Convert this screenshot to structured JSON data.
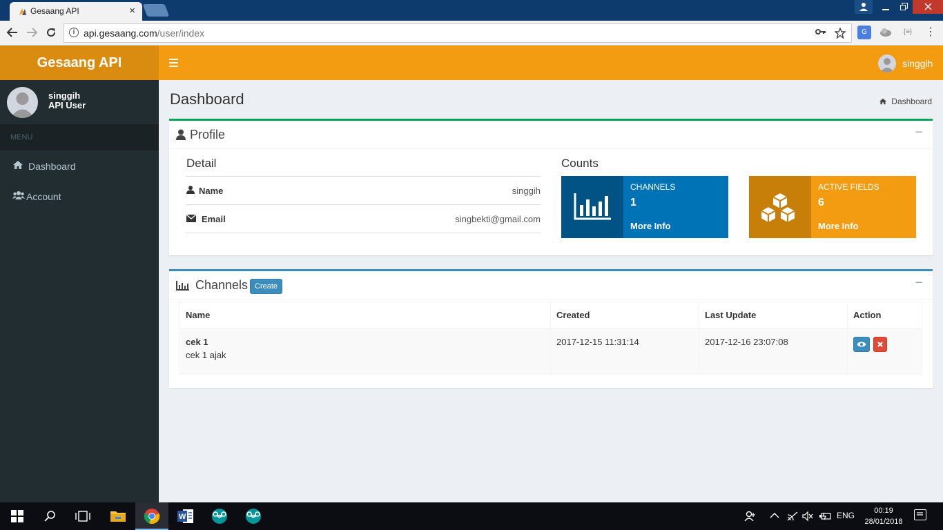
{
  "browser": {
    "tab_title": "Gesaang API",
    "tab_close": "×",
    "url_host": "api.gesaang.com",
    "url_path": "/user/index"
  },
  "app": {
    "logo": "Gesaang API",
    "top_user": "singgih"
  },
  "sidebar": {
    "user_name": "singgih",
    "user_role": "API User",
    "menu_header": "MENU",
    "items": [
      {
        "label": "Dashboard",
        "icon": "home-icon"
      },
      {
        "label": "Account",
        "icon": "users-icon"
      }
    ]
  },
  "page": {
    "title": "Dashboard",
    "breadcrumb": "Dashboard"
  },
  "profile": {
    "box_title": "Profile",
    "collapse": "−",
    "detail_title": "Detail",
    "rows": [
      {
        "label": "Name",
        "value": "singgih",
        "icon": "user-icon"
      },
      {
        "label": "Email",
        "value": "singbekti@gmail.com",
        "icon": "envelope-icon"
      }
    ],
    "counts_title": "Counts",
    "counts": [
      {
        "label": "CHANNELS",
        "value": "1",
        "more": "More Info",
        "icon": "bar-chart-icon",
        "color": "#0073b7"
      },
      {
        "label": "ACTIVE FIELDS",
        "value": "6",
        "more": "More Info",
        "icon": "cubes-icon",
        "color": "#f39c12"
      }
    ]
  },
  "channels": {
    "box_title": "Channels",
    "create_label": "Create",
    "collapse": "−",
    "columns": [
      "Name",
      "Created",
      "Last Update",
      "Action"
    ],
    "rows": [
      {
        "name": "cek 1",
        "description": "cek 1 ajak",
        "created": "2017-12-15 11:31:14",
        "updated": "2017-12-16 23:07:08"
      }
    ]
  },
  "taskbar": {
    "lang": "ENG",
    "time": "00:19",
    "date": "28/01/2018"
  },
  "colors": {
    "accent": "#f39c12",
    "sidebar": "#222d32",
    "primary": "#3c8dbc",
    "success": "#00a65a",
    "danger": "#dd4b39"
  }
}
